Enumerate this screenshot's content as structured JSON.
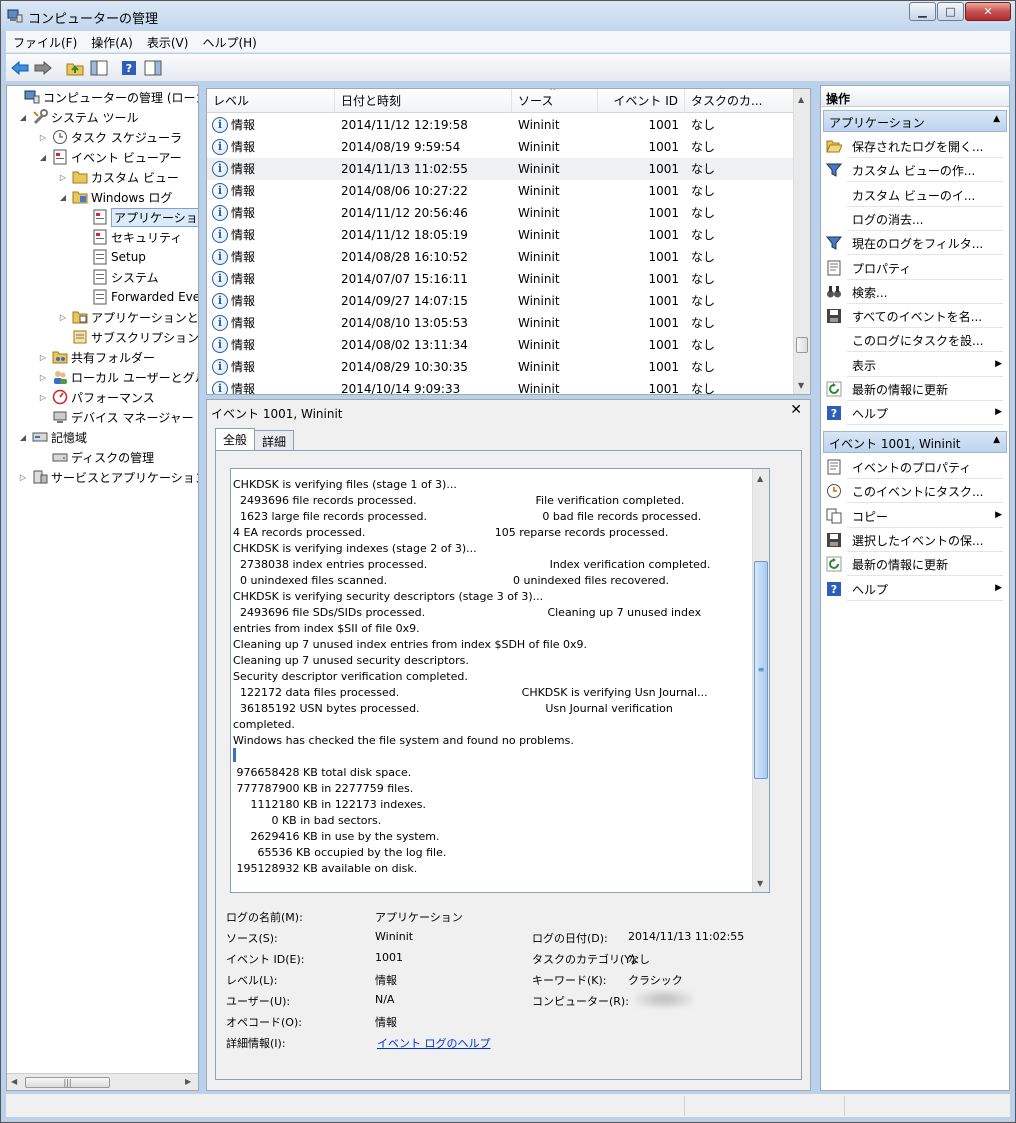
{
  "window": {
    "title": "コンピューターの管理"
  },
  "menu": [
    "ファイル(F)",
    "操作(A)",
    "表示(V)",
    "ヘルプ(H)"
  ],
  "tree": [
    {
      "label": "コンピューターの管理 (ローカル)",
      "level": 0,
      "exp": ""
    },
    {
      "label": "システム ツール",
      "level": 1,
      "exp": "◢"
    },
    {
      "label": "タスク スケジューラ",
      "level": 2,
      "exp": "▷"
    },
    {
      "label": "イベント ビューアー",
      "level": 2,
      "exp": "◢"
    },
    {
      "label": "カスタム ビュー",
      "level": 3,
      "exp": "▷"
    },
    {
      "label": "Windows ログ",
      "level": 3,
      "exp": "◢"
    },
    {
      "label": "アプリケーション",
      "level": 4,
      "exp": "",
      "selected": true
    },
    {
      "label": "セキュリティ",
      "level": 4,
      "exp": ""
    },
    {
      "label": "Setup",
      "level": 4,
      "exp": ""
    },
    {
      "label": "システム",
      "level": 4,
      "exp": ""
    },
    {
      "label": "Forwarded Events",
      "level": 4,
      "exp": ""
    },
    {
      "label": "アプリケーションとサービス ログ",
      "level": 3,
      "exp": "▷"
    },
    {
      "label": "サブスクリプション",
      "level": 3,
      "exp": ""
    },
    {
      "label": "共有フォルダー",
      "level": 2,
      "exp": "▷"
    },
    {
      "label": "ローカル ユーザーとグループ",
      "level": 2,
      "exp": "▷"
    },
    {
      "label": "パフォーマンス",
      "level": 2,
      "exp": "▷"
    },
    {
      "label": "デバイス マネージャー",
      "level": 2,
      "exp": ""
    },
    {
      "label": "記憶域",
      "level": 1,
      "exp": "◢"
    },
    {
      "label": "ディスクの管理",
      "level": 2,
      "exp": ""
    },
    {
      "label": "サービスとアプリケーション",
      "level": 1,
      "exp": "▷"
    }
  ],
  "list": {
    "columns": [
      "レベル",
      "日付と時刻",
      "ソース",
      "イベント ID",
      "タスクのカ..."
    ],
    "rows": [
      [
        "情報",
        "2014/11/12 12:19:58",
        "Wininit",
        "1001",
        "なし"
      ],
      [
        "情報",
        "2014/08/19 9:59:54",
        "Wininit",
        "1001",
        "なし"
      ],
      [
        "情報",
        "2014/11/13 11:02:55",
        "Wininit",
        "1001",
        "なし"
      ],
      [
        "情報",
        "2014/08/06 10:27:22",
        "Wininit",
        "1001",
        "なし"
      ],
      [
        "情報",
        "2014/11/12 20:56:46",
        "Wininit",
        "1001",
        "なし"
      ],
      [
        "情報",
        "2014/11/12 18:05:19",
        "Wininit",
        "1001",
        "なし"
      ],
      [
        "情報",
        "2014/08/28 16:10:52",
        "Wininit",
        "1001",
        "なし"
      ],
      [
        "情報",
        "2014/07/07 15:16:11",
        "Wininit",
        "1001",
        "なし"
      ],
      [
        "情報",
        "2014/09/27 14:07:15",
        "Wininit",
        "1001",
        "なし"
      ],
      [
        "情報",
        "2014/08/10 13:05:53",
        "Wininit",
        "1001",
        "なし"
      ],
      [
        "情報",
        "2014/08/02 13:11:34",
        "Wininit",
        "1001",
        "なし"
      ],
      [
        "情報",
        "2014/08/29 10:30:35",
        "Wininit",
        "1001",
        "なし"
      ],
      [
        "情報",
        "2014/10/14 9:09:33",
        "Wininit",
        "1001",
        "なし"
      ]
    ]
  },
  "detail": {
    "title": "イベント 1001, Wininit",
    "tabs": [
      "全般",
      "詳細"
    ],
    "description": [
      "CHKDSK is verifying files (stage 1 of 3)...",
      "  2493696 file records processed.                                  File verification completed.",
      "  1623 large file records processed.                                 0 bad file records processed.",
      "4 EA records processed.                                     105 reparse records processed.",
      "CHKDSK is verifying indexes (stage 2 of 3)...",
      "  2738038 index entries processed.                                   Index verification completed.",
      "  0 unindexed files scanned.                                    0 unindexed files recovered.",
      "CHKDSK is verifying security descriptors (stage 3 of 3)...",
      "  2493696 file SDs/SIDs processed.                                   Cleaning up 7 unused index",
      "entries from index $SII of file 0x9.",
      "Cleaning up 7 unused index entries from index $SDH of file 0x9.",
      "Cleaning up 7 unused security descriptors.",
      "Security descriptor verification completed.",
      "  122172 data files processed.                                   CHKDSK is verifying Usn Journal...",
      "  36185192 USN bytes processed.                                    Usn Journal verification",
      "completed.",
      "Windows has checked the file system and found no problems.",
      "",
      " 976658428 KB total disk space.",
      " 777787900 KB in 2277759 files.",
      "     1112180 KB in 122173 indexes.",
      "           0 KB in bad sectors.",
      "     2629416 KB in use by the system.",
      "       65536 KB occupied by the log file.",
      " 195128932 KB available on disk."
    ],
    "props": {
      "log_name_label": "ログの名前(M):",
      "log_name": "アプリケーション",
      "source_label": "ソース(S):",
      "source": "Wininit",
      "logged_label": "ログの日付(D):",
      "logged": "2014/11/13 11:02:55",
      "event_id_label": "イベント ID(E):",
      "event_id": "1001",
      "task_label": "タスクのカテゴリ(Y):",
      "task": "なし",
      "level_label": "レベル(L):",
      "level": "情報",
      "keywords_label": "キーワード(K):",
      "keywords": "クラシック",
      "user_label": "ユーザー(U):",
      "user": "N/A",
      "computer_label": "コンピューター(R):",
      "opcode_label": "オペコード(O):",
      "opcode": "情報",
      "more_info_label": "詳細情報(I):",
      "more_info": "イベント ログのヘルプ"
    }
  },
  "actions": {
    "header": "操作",
    "section1": "アプリケーション",
    "items1": [
      {
        "label": "保存されたログを開く...",
        "icon": "folder-open-icon"
      },
      {
        "label": "カスタム ビューの作...",
        "icon": "filter-icon"
      },
      {
        "label": "カスタム ビューのイ...",
        "icon": ""
      },
      {
        "label": "ログの消去...",
        "icon": ""
      },
      {
        "label": "現在のログをフィルタ...",
        "icon": "filter-icon"
      },
      {
        "label": "プロパティ",
        "icon": "properties-icon"
      },
      {
        "label": "検索...",
        "icon": "binoculars-icon"
      },
      {
        "label": "すべてのイベントを名...",
        "icon": "save-icon"
      },
      {
        "label": "このログにタスクを設...",
        "icon": ""
      },
      {
        "label": "表示",
        "icon": "",
        "sub": true
      },
      {
        "label": "最新の情報に更新",
        "icon": "refresh-icon"
      },
      {
        "label": "ヘルプ",
        "icon": "help-icon",
        "sub": true
      }
    ],
    "section2": "イベント 1001, Wininit",
    "items2": [
      {
        "label": "イベントのプロパティ",
        "icon": "properties-icon"
      },
      {
        "label": "このイベントにタスク...",
        "icon": "task-icon"
      },
      {
        "label": "コピー",
        "icon": "copy-icon",
        "sub": true
      },
      {
        "label": "選択したイベントの保...",
        "icon": "save-icon"
      },
      {
        "label": "最新の情報に更新",
        "icon": "refresh-icon"
      },
      {
        "label": "ヘルプ",
        "icon": "help-icon",
        "sub": true
      }
    ]
  }
}
